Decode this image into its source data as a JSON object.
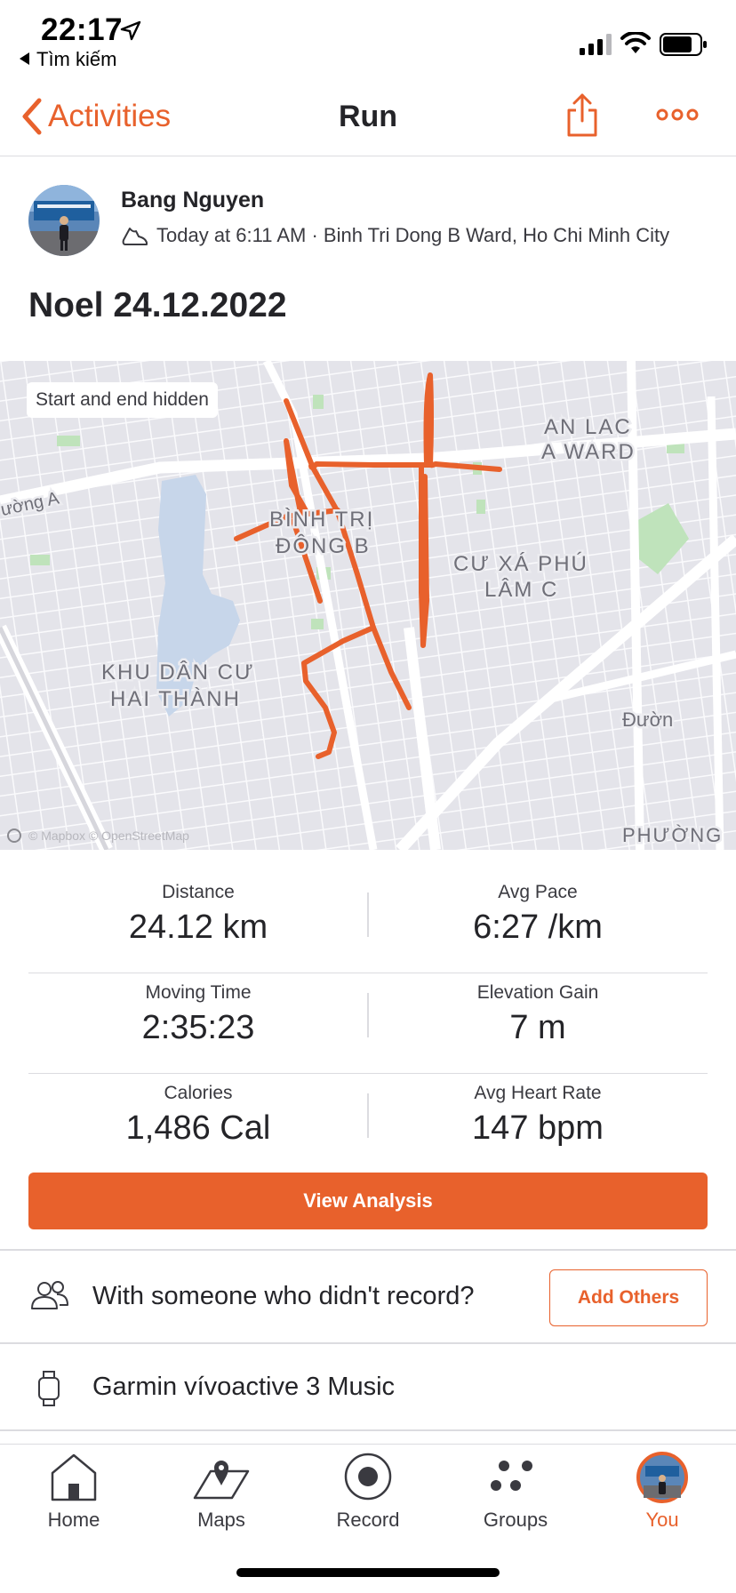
{
  "status_bar": {
    "time": "22:17",
    "back_label": "Tìm kiếm"
  },
  "nav": {
    "back_label": "Activities",
    "title": "Run"
  },
  "athlete": {
    "name": "Bang Nguyen",
    "meta": "Today at 6:11 AM · Binh Tri Dong B Ward, Ho Chi Minh City"
  },
  "activity": {
    "title": "Noel 24.12.2022"
  },
  "map": {
    "chip": "Start and end hidden",
    "attribution": "© Mapbox © OpenStreetMap",
    "labels": {
      "binh_tri_1": "BÌNH TRỊ",
      "binh_tri_2": "ĐÔNG B",
      "an_lac_1": "AN LAC",
      "an_lac_2": "A WARD",
      "cu_xa_1": "CƯ XÁ PHÚ",
      "cu_xa_2": "LÂM C",
      "khu_dan_cu_1": "KHU DÂN CƯ",
      "khu_dan_cu_2": "HAI THÀNH",
      "duong_a": "ường A",
      "duong_right": "Đườn",
      "phuong": "PHƯỜNG"
    },
    "route_color": "#e8612c"
  },
  "stats": [
    {
      "left": {
        "label": "Distance",
        "value": "24.12 km"
      },
      "right": {
        "label": "Avg Pace",
        "value": "6:27 /km"
      }
    },
    {
      "left": {
        "label": "Moving Time",
        "value": "2:35:23"
      },
      "right": {
        "label": "Elevation Gain",
        "value": "7 m"
      }
    },
    {
      "left": {
        "label": "Calories",
        "value": "1,486 Cal"
      },
      "right": {
        "label": "Avg Heart Rate",
        "value": "147 bpm"
      }
    }
  ],
  "view_analysis_label": "View Analysis",
  "with_others": {
    "text": "With someone who didn't record?",
    "button": "Add Others"
  },
  "device": {
    "name": "Garmin vívoactive 3 Music"
  },
  "tabbar": {
    "items": [
      {
        "label": "Home",
        "icon": "home-icon"
      },
      {
        "label": "Maps",
        "icon": "map-icon"
      },
      {
        "label": "Record",
        "icon": "record-icon"
      },
      {
        "label": "Groups",
        "icon": "groups-icon"
      },
      {
        "label": "You",
        "icon": "avatar"
      }
    ],
    "active": "You"
  },
  "colors": {
    "brand": "#e8612c",
    "text": "#242428",
    "divider": "#dcdce0"
  }
}
